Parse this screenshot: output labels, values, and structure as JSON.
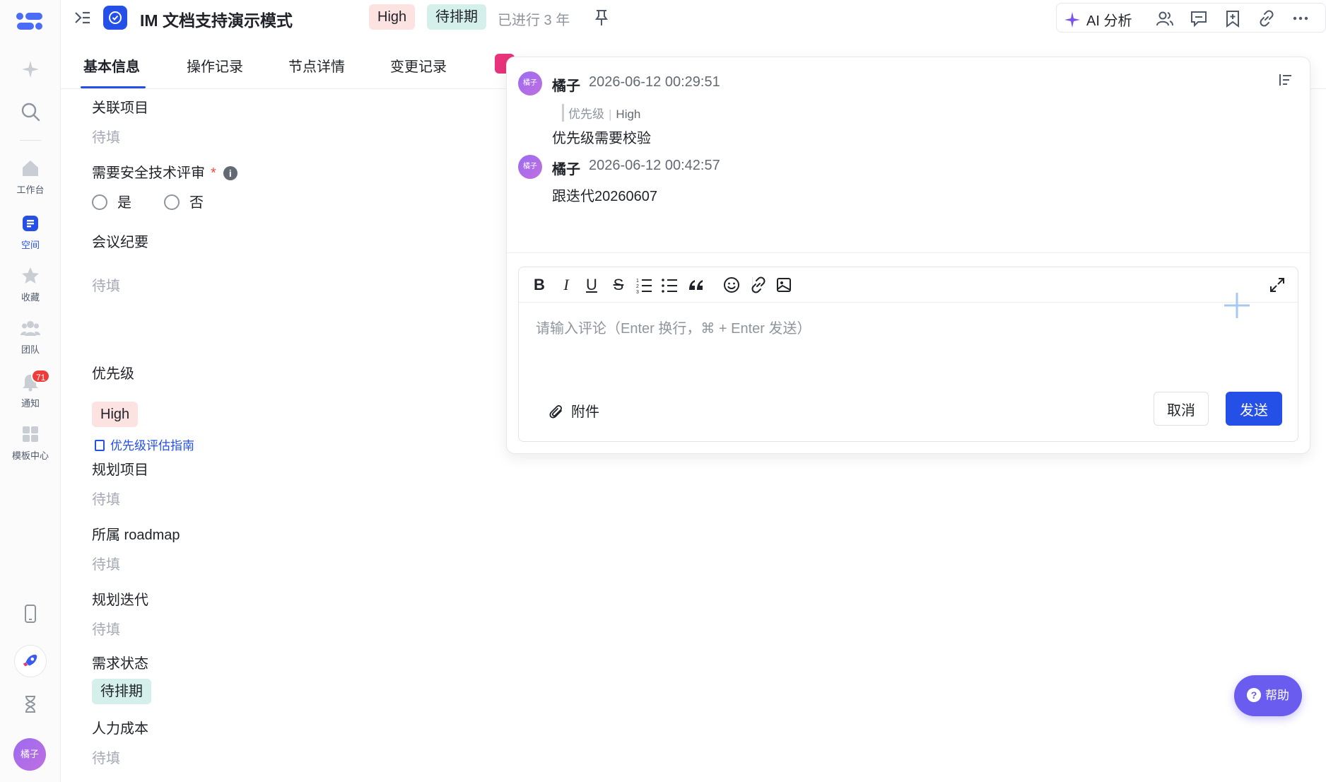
{
  "rail": {
    "items": [
      {
        "label": ""
      },
      {
        "label": ""
      },
      {
        "label": "工作台"
      },
      {
        "label": "空间"
      },
      {
        "label": "收藏"
      },
      {
        "label": "团队"
      },
      {
        "label": "通知"
      },
      {
        "label": "模板中心"
      }
    ],
    "notification_count": "71",
    "user_avatar": "橘子",
    "active_color": "#2450e8"
  },
  "header": {
    "title": "IM 文档支持演示模式",
    "priority_tag": "High",
    "status_tag": "待排期",
    "elapsed": "已进行 3 年",
    "ai_label": "AI 分析"
  },
  "tabs": [
    {
      "label": "基本信息"
    },
    {
      "label": "操作记录"
    },
    {
      "label": "节点详情"
    },
    {
      "label": "变更记录"
    }
  ],
  "form": {
    "related_project": {
      "label": "关联项目",
      "value": "待填"
    },
    "security_review": {
      "label": "需要安全技术评审",
      "required_mark": "*",
      "options": [
        "是",
        "否"
      ]
    },
    "meeting_notes": {
      "label": "会议纪要",
      "value": "待填"
    },
    "priority": {
      "label": "优先级",
      "value": "High",
      "guide_link": "优先级评估指南"
    },
    "planned_project": {
      "label": "规划项目",
      "value": "待填"
    },
    "roadmap": {
      "label": "所属 roadmap",
      "value": "待填"
    },
    "planned_iteration": {
      "label": "规划迭代",
      "value": "待填"
    },
    "requirement_status": {
      "label": "需求状态",
      "value": "待排期"
    },
    "labor_cost": {
      "label": "人力成本",
      "value": "待填"
    }
  },
  "comments": [
    {
      "avatar": "橘子",
      "author": "橘子",
      "time": "2026-06-12 00:29:51",
      "quote_field": "优先级",
      "quote_value": "High",
      "body": "优先级需要校验"
    },
    {
      "avatar": "橘子",
      "author": "橘子",
      "time": "2026-06-12 00:42:57",
      "body": "跟迭代20260607"
    }
  ],
  "editor": {
    "placeholder": "请输入评论（Enter 换行，⌘ + Enter 发送）",
    "attach_label": "附件",
    "cancel_label": "取消",
    "send_label": "发送"
  },
  "help": {
    "label": "帮助",
    "glyph": "?"
  },
  "colors": {
    "brand": "#2450e8",
    "high_tag_bg": "#fde2e2",
    "status_tag_bg": "#d5f0ea",
    "help_bg": "#6b5cf0"
  }
}
